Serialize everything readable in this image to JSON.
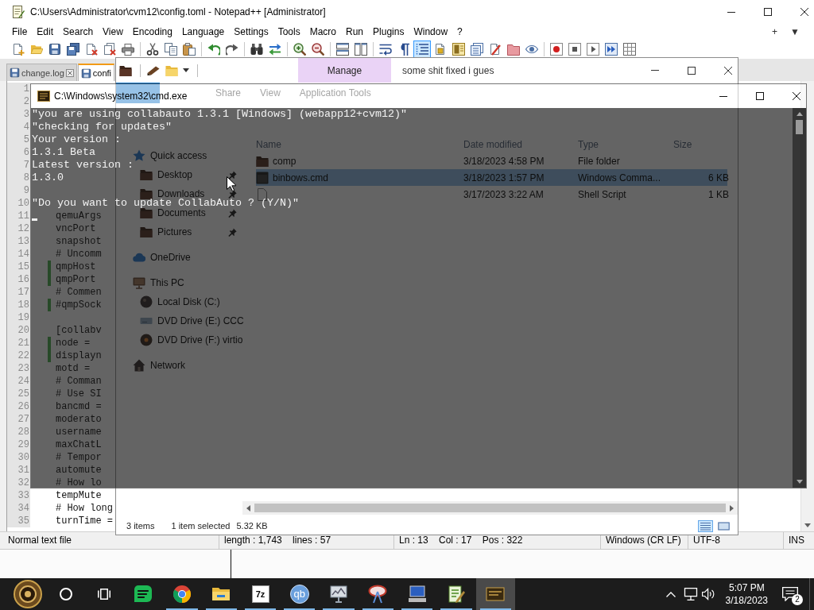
{
  "editor": {
    "title": "C:\\Users\\Administrator\\cvm12\\config.toml - Notepad++ [Administrator]",
    "menu": [
      "File",
      "Edit",
      "Search",
      "View",
      "Encoding",
      "Language",
      "Settings",
      "Tools",
      "Macro",
      "Run",
      "Plugins",
      "Window",
      "?"
    ],
    "menu_buttons": [
      "+",
      "▼"
    ],
    "toolbar_groups": [
      {
        "buttons": [
          {
            "kind": "new",
            "pressed": false
          },
          {
            "kind": "open",
            "pressed": false
          },
          {
            "kind": "save",
            "pressed": false
          },
          {
            "kind": "saveall",
            "pressed": false
          },
          {
            "kind": "close",
            "pressed": false
          },
          {
            "kind": "closeall",
            "pressed": false
          },
          {
            "kind": "print",
            "pressed": false
          }
        ]
      },
      {
        "buttons": [
          {
            "kind": "cut",
            "pressed": false
          },
          {
            "kind": "copy",
            "pressed": false
          },
          {
            "kind": "paste",
            "pressed": false
          }
        ]
      },
      {
        "buttons": [
          {
            "kind": "undo",
            "pressed": false
          },
          {
            "kind": "redo",
            "pressed": false
          }
        ]
      },
      {
        "buttons": [
          {
            "kind": "find",
            "pressed": false
          },
          {
            "kind": "replace",
            "pressed": false
          }
        ]
      },
      {
        "buttons": [
          {
            "kind": "zoomin",
            "pressed": false
          },
          {
            "kind": "zoomout",
            "pressed": false
          }
        ]
      },
      {
        "buttons": [
          {
            "kind": "syncv",
            "pressed": false
          },
          {
            "kind": "synch",
            "pressed": false
          }
        ]
      },
      {
        "buttons": [
          {
            "kind": "wrap",
            "pressed": false
          },
          {
            "kind": "showall",
            "pressed": false
          },
          {
            "kind": "indent",
            "pressed": true
          },
          {
            "kind": "udl",
            "pressed": false
          },
          {
            "kind": "docmap",
            "pressed": false
          },
          {
            "kind": "funclist",
            "pressed": false
          },
          {
            "kind": "workspace",
            "pressed": false
          },
          {
            "kind": "monitor",
            "pressed": false
          },
          {
            "kind": "eye",
            "pressed": false
          }
        ]
      },
      {
        "buttons": [
          {
            "kind": "record",
            "pressed": false
          },
          {
            "kind": "stop",
            "pressed": false
          },
          {
            "kind": "play",
            "pressed": false
          },
          {
            "kind": "playmulti",
            "pressed": false
          },
          {
            "kind": "savemacro",
            "pressed": false
          }
        ]
      }
    ],
    "tabs": [
      {
        "label": "change.log",
        "selected": false
      },
      {
        "label": "confi",
        "selected": true
      }
    ],
    "lines": [
      {
        "number": "1",
        "changed": false
      },
      {
        "number": "2",
        "changed": false
      },
      {
        "number": "3",
        "changed": false
      },
      {
        "number": "4",
        "changed": false
      },
      {
        "number": "5",
        "changed": false
      },
      {
        "number": "6",
        "changed": false
      },
      {
        "number": "7",
        "changed": false
      },
      {
        "number": "8",
        "changed": false
      },
      {
        "number": "9",
        "changed": false
      },
      {
        "number": "10",
        "changed": false
      },
      {
        "number": "11",
        "code": "qemuArgs",
        "changed": false
      },
      {
        "number": "12",
        "code": "vncPort",
        "changed": false
      },
      {
        "number": "13",
        "code": "snapshot",
        "changed": false
      },
      {
        "number": "14",
        "code": "# Uncomm",
        "changed": false
      },
      {
        "number": "15",
        "code": "qmpHost",
        "changed": true
      },
      {
        "number": "16",
        "code": "qmpPort",
        "changed": true
      },
      {
        "number": "17",
        "code": "# Commen",
        "changed": false
      },
      {
        "number": "18",
        "code": "#qmpSock",
        "changed": true
      },
      {
        "number": "19",
        "changed": false
      },
      {
        "number": "20",
        "code": "[collabv",
        "changed": false
      },
      {
        "number": "21",
        "code": "node =",
        "changed": true
      },
      {
        "number": "22",
        "code": "displayn",
        "changed": true
      },
      {
        "number": "23",
        "code": "motd =",
        "changed": false
      },
      {
        "number": "24",
        "code": "# Comman",
        "changed": false
      },
      {
        "number": "25",
        "code": "# Use SI",
        "changed": false
      },
      {
        "number": "26",
        "code": "bancmd =",
        "changed": false
      },
      {
        "number": "27",
        "code": "moderato",
        "changed": false
      },
      {
        "number": "28",
        "code": "username",
        "changed": false
      },
      {
        "number": "29",
        "code": "maxChatL",
        "changed": false
      },
      {
        "number": "30",
        "code": "# Tempor",
        "changed": false
      },
      {
        "number": "31",
        "code": "automute",
        "changed": false
      },
      {
        "number": "32",
        "code": "# How lo",
        "changed": false
      },
      {
        "number": "33",
        "code": "tempMute",
        "changed": false
      },
      {
        "number": "34",
        "code": "# How long",
        "changed": false
      },
      {
        "number": "35",
        "code": "turnTime =",
        "changed": false
      }
    ],
    "status": [
      "Normal text file",
      "length : 1,743    lines : 57",
      "Ln : 13    Col : 17    Pos : 322",
      "Windows (CR LF)",
      "UTF-8",
      "INS"
    ]
  },
  "explorer": {
    "title": "some shit fixed i gues",
    "context_tab": "Manage",
    "ribbon_tabs": [
      "Share",
      "View",
      "Application Tools"
    ],
    "nav": [
      {
        "label": "Quick access",
        "kind": "star",
        "pinned": false,
        "children": [
          {
            "label": "Desktop",
            "kind": "folder",
            "pinned": true
          },
          {
            "label": "Downloads",
            "kind": "folder",
            "pinned": true
          },
          {
            "label": "Documents",
            "kind": "folder",
            "pinned": true
          },
          {
            "label": "Pictures",
            "kind": "folder",
            "pinned": true
          }
        ]
      },
      {
        "label": "OneDrive",
        "kind": "cloud",
        "pinned": false
      },
      {
        "label": "This PC",
        "kind": "pc",
        "pinned": false,
        "children": [
          {
            "label": "Local Disk (C:)",
            "kind": "disk",
            "pinned": false
          },
          {
            "label": "DVD Drive (E:) CCC",
            "kind": "drive",
            "pinned": false
          },
          {
            "label": "DVD Drive (F:) virtio",
            "kind": "disc",
            "pinned": false
          }
        ]
      },
      {
        "label": "Network",
        "kind": "network",
        "pinned": false
      }
    ],
    "columns": [
      "Name",
      "Date modified",
      "Type",
      "Size"
    ],
    "files": [
      {
        "kind": "folder",
        "name": "comp",
        "modified": "3/18/2023 4:58 PM",
        "type": "File folder",
        "selected": false
      },
      {
        "kind": "command",
        "name": "binbows.cmd",
        "modified": "3/18/2023 1:57 PM",
        "type": "Windows Comma...",
        "size": "6 KB",
        "selected": true
      },
      {
        "kind": "script",
        "modified": "3/17/2023 3:22 AM",
        "type": "Shell Script",
        "size": "1 KB",
        "selected": false
      }
    ],
    "status": {
      "items": "3 items",
      "selection": "1 item selected",
      "size": "5.32 KB"
    },
    "views": [
      {
        "kind": "details",
        "selected": true
      },
      {
        "kind": "tiles",
        "selected": false
      }
    ]
  },
  "console": {
    "title": "C:\\Windows\\system32\\cmd.exe",
    "paragraphs": [
      [
        "\"you are using collabauto 1.3.1 [Windows] (webapp12+cvm12)\"",
        "\"checking for updates\"",
        "Your version :",
        "1.3.1 Beta",
        "Latest version :",
        "1.3.0"
      ],
      [
        "\"Do you want to update CollabAuto ? (Y/N)\""
      ]
    ],
    "cursor": true
  },
  "taskbar": {
    "apps": [
      {
        "kind": "chat",
        "running": false,
        "selected": false
      },
      {
        "kind": "browser",
        "running": true,
        "selected": false
      },
      {
        "kind": "folder",
        "running": true,
        "selected": false
      },
      {
        "kind": "archive",
        "label": "7z",
        "running": true,
        "selected": false
      },
      {
        "kind": "torrent",
        "label": "qb",
        "running": true,
        "selected": false
      },
      {
        "kind": "monitor",
        "running": true,
        "selected": false
      },
      {
        "kind": "dish",
        "running": true,
        "selected": false
      },
      {
        "kind": "computer",
        "running": true,
        "selected": false
      },
      {
        "kind": "notepad",
        "running": true,
        "selected": false
      },
      {
        "kind": "terminal",
        "running": true,
        "selected": true
      }
    ],
    "clock": {
      "time": "5:07 PM",
      "date": "3/18/2023"
    },
    "notifications": "2"
  }
}
